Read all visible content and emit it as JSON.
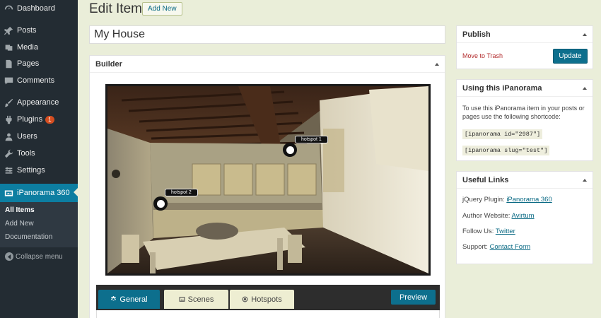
{
  "sidebar": {
    "items": [
      {
        "label": "Dashboard",
        "icon": "dashboard-icon"
      },
      {
        "label": "Posts",
        "icon": "pin-icon"
      },
      {
        "label": "Media",
        "icon": "media-icon"
      },
      {
        "label": "Pages",
        "icon": "pages-icon"
      },
      {
        "label": "Comments",
        "icon": "comment-icon"
      },
      {
        "label": "Appearance",
        "icon": "brush-icon"
      },
      {
        "label": "Plugins",
        "icon": "plugin-icon",
        "badge": "1"
      },
      {
        "label": "Users",
        "icon": "users-icon"
      },
      {
        "label": "Tools",
        "icon": "wrench-icon"
      },
      {
        "label": "Settings",
        "icon": "settings-icon"
      },
      {
        "label": "iPanorama 360",
        "icon": "panorama-icon"
      }
    ],
    "submenu": [
      "All Items",
      "Add New",
      "Documentation"
    ],
    "collapse_label": "Collapse menu"
  },
  "header": {
    "title": "Edit Item",
    "add_new_label": "Add New"
  },
  "item_title": "My House",
  "builder": {
    "title": "Builder",
    "hotspots": [
      {
        "label": "hotspot 1"
      },
      {
        "label": "hotspot 2"
      }
    ],
    "tabs": [
      {
        "label": "General",
        "icon": "gear-icon"
      },
      {
        "label": "Scenes",
        "icon": "image-icon"
      },
      {
        "label": "Hotspots",
        "icon": "target-icon"
      }
    ],
    "preview_label": "Preview"
  },
  "publish": {
    "title": "Publish",
    "trash_label": "Move to Trash",
    "update_label": "Update"
  },
  "using": {
    "title": "Using this iPanorama",
    "description": "To use this iPanorama item in your posts or pages use the following shortcode:",
    "shortcode_id": "[ipanorama id=\"2987\"]",
    "shortcode_slug": "[ipanorama slug=\"test\"]"
  },
  "links": {
    "title": "Useful Links",
    "rows": [
      {
        "prefix": "jQuery Plugin:",
        "link": "iPanorama 360"
      },
      {
        "prefix": "Author Website:",
        "link": "Avirtum"
      },
      {
        "prefix": "Follow Us:",
        "link": "Twitter"
      },
      {
        "prefix": "Support:",
        "link": "Contact Form"
      }
    ]
  },
  "colors": {
    "sidebar_bg": "#232c33",
    "accent": "#0d6f8d",
    "page_bg": "#eaeed9",
    "badge": "#d54e21"
  }
}
